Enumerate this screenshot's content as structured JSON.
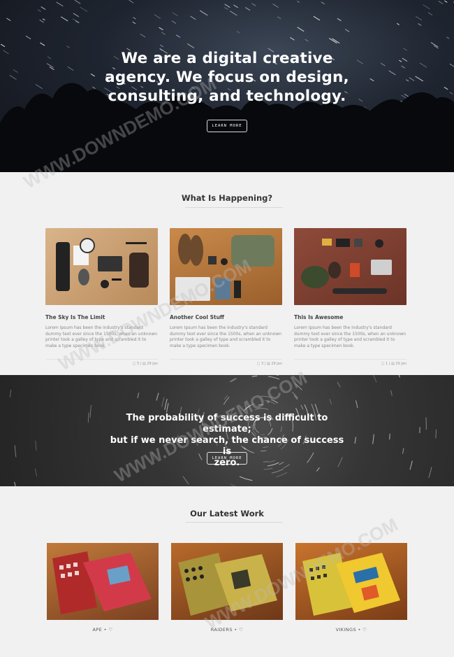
{
  "hero": {
    "title_lines": [
      "We are a digital creative",
      "agency. We focus on design,",
      "consulting, and technology."
    ],
    "cta_label": "LEARN MORE"
  },
  "happening": {
    "heading": "What Is Happening?",
    "posts": [
      {
        "title": "The Sky Is The Limit",
        "excerpt": "Lorem Ipsum has been the industry's standard dummy text ever since the 1500s, when an unknown printer took a galley of type and scrambled it to make a type specimen book.",
        "meta": "□ 5 | ▤ 29 Jan"
      },
      {
        "title": "Another Cool Stuff",
        "excerpt": "Lorem Ipsum has been the industry's standard dummy text ever since the 1500s, when an unknown printer took a galley of type and scrambled it to make a type specimen book.",
        "meta": "□ 3 | ▤ 29 Jan"
      },
      {
        "title": "This Is Awesome",
        "excerpt": "Lorem Ipsum has been the industry's standard dummy text ever since the 1500s, when an unknown printer took a galley of type and scrambled it to make a type specimen book.",
        "meta": "□ 1 | ▤ 29 Jan"
      }
    ]
  },
  "quote": {
    "lines": [
      "The probability of success is difficult to estimate;",
      "but if we never search, the chance of success is",
      "zero."
    ],
    "cta_label": "LEARN MORE"
  },
  "work": {
    "heading": "Our Latest Work",
    "items": [
      {
        "name": "APE",
        "heart": "♡"
      },
      {
        "name": "RAIDERS",
        "heart": "♡"
      },
      {
        "name": "VIKINGS",
        "heart": "♡"
      }
    ]
  },
  "watermark": "WWW.DOWNDEMO.COM",
  "colors": {
    "hero_bg": "#1f2530",
    "quote_bg": "#353535",
    "page_bg": "#f1f1f1",
    "accent_wood": "#b86a2a"
  }
}
